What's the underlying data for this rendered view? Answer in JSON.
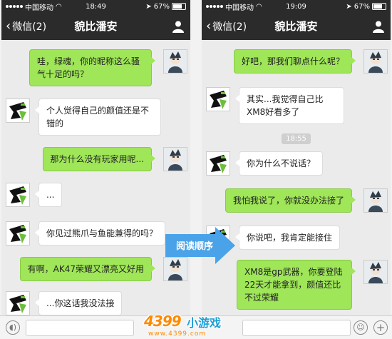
{
  "status_bar": {
    "carrier": "中国移动",
    "battery": "67%",
    "battery_level": 0.67
  },
  "left_screen": {
    "time": "18:49",
    "back_label": "微信(2)",
    "title": "貌比潘安",
    "messages": [
      {
        "from": "me",
        "text": "哇，绿魂，你的昵称这么骚气十足的吗？"
      },
      {
        "from": "other",
        "text": "个人觉得自己的颜值还是不错的"
      },
      {
        "from": "me",
        "text": "那为什么没有玩家用呢..."
      },
      {
        "from": "other",
        "text": "..."
      },
      {
        "from": "other",
        "text": "你见过熊爪与鱼能兼得的吗？"
      },
      {
        "from": "me",
        "text": "有啊，AK47荣耀又漂亮又好用"
      },
      {
        "from": "other",
        "text": "...你这话我没法接"
      }
    ]
  },
  "right_screen": {
    "time": "19:09",
    "back_label": "微信(2)",
    "title": "貌比潘安",
    "timestamp": "18:55",
    "messages": [
      {
        "from": "me",
        "text": "好吧，那我们聊点什么呢？"
      },
      {
        "from": "other",
        "text": "其实...我觉得自己比XM8好看多了"
      },
      {
        "from": "other",
        "text": "你为什么不说话？"
      },
      {
        "from": "me",
        "text": "我怕我说了，你就没办法接了"
      },
      {
        "from": "other",
        "text": "你说吧，我肯定能接住"
      },
      {
        "from": "me",
        "text": "XM8是gp武器，你要登陆22天才能拿到，颜值还比不过荣耀"
      }
    ]
  },
  "reading_order_label": "阅读顺序",
  "watermark": {
    "brand": "4399",
    "slogan": "小游戏",
    "url": "www.4399.com"
  },
  "colors": {
    "nav_bg": "#2b2b2b",
    "my_bubble": "#9fe658",
    "their_bubble": "#ffffff",
    "chat_bg": "#ebebeb",
    "arrow": "#4aa3e8"
  }
}
